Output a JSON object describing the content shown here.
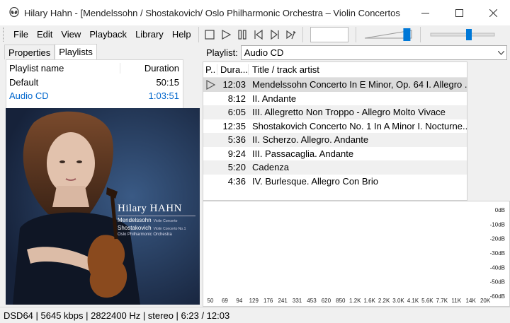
{
  "window": {
    "title": "Hilary Hahn - [Mendelssohn / Shostakovich/ Oslo Philharmonic Orchestra – Violin Concertos",
    "app_icon": "alien-icon"
  },
  "menu": {
    "items": [
      "File",
      "Edit",
      "View",
      "Playback",
      "Library",
      "Help"
    ]
  },
  "toolbar": {
    "buttons": [
      "stop-icon",
      "play-icon",
      "pause-icon",
      "previous-icon",
      "next-icon",
      "random-icon"
    ],
    "volume_level": 0.9,
    "seek_position": 0.6
  },
  "left_tabs": [
    "Properties",
    "Playlists"
  ],
  "playlists": {
    "headers": {
      "name": "Playlist name",
      "duration": "Duration"
    },
    "rows": [
      {
        "name": "Default",
        "duration": "50:15"
      },
      {
        "name": "Audio CD",
        "duration": "1:03:51"
      }
    ]
  },
  "cover": {
    "artist": "Hilary HAHN",
    "line1": "Mendelssohn",
    "line1b": "Violin Concerto",
    "line2": "Shostakovich",
    "line2b": "Violin Concerto No.1",
    "line3": "Oslo Philharmonic Orchestra"
  },
  "playlist_select": {
    "label": "Playlist:",
    "value": "Audio CD"
  },
  "tracks": {
    "headers": {
      "icon": "P..",
      "duration": "Dura...",
      "title": "Title / track artist"
    },
    "rows": [
      {
        "duration": "12:03",
        "title": "Mendelssohn Concerto In E Minor, Op. 64 I. Allegro ...",
        "playing": true
      },
      {
        "duration": "8:12",
        "title": "II. Andante"
      },
      {
        "duration": "6:05",
        "title": "III. Allegretto Non Troppo - Allegro Molto Vivace"
      },
      {
        "duration": "12:35",
        "title": "Shostakovich Concerto No. 1 In A Minor I. Nocturne..."
      },
      {
        "duration": "5:36",
        "title": "II. Scherzo. Allegro. Andante"
      },
      {
        "duration": "9:24",
        "title": "III. Passacaglia. Andante"
      },
      {
        "duration": "5:20",
        "title": "Cadenza"
      },
      {
        "duration": "4:36",
        "title": "IV. Burlesque. Allegro Con Brio"
      }
    ]
  },
  "spectrum": {
    "db_labels": [
      "0dB",
      "-10dB",
      "-20dB",
      "-30dB",
      "-40dB",
      "-50dB",
      "-60dB"
    ],
    "freq_labels": [
      "50",
      "69",
      "94",
      "129",
      "176",
      "241",
      "331",
      "453",
      "620",
      "850",
      "1.2K",
      "1.6K",
      "2.2K",
      "3.0K",
      "4.1K",
      "5.6K",
      "7.7K",
      "11K",
      "14K",
      "20K"
    ]
  },
  "status": {
    "text": "DSD64 | 5645 kbps | 2822400 Hz | stereo | 6:23 / 12:03"
  },
  "colors": {
    "accent": "#0078d7",
    "selected_text": "#0066cc"
  }
}
